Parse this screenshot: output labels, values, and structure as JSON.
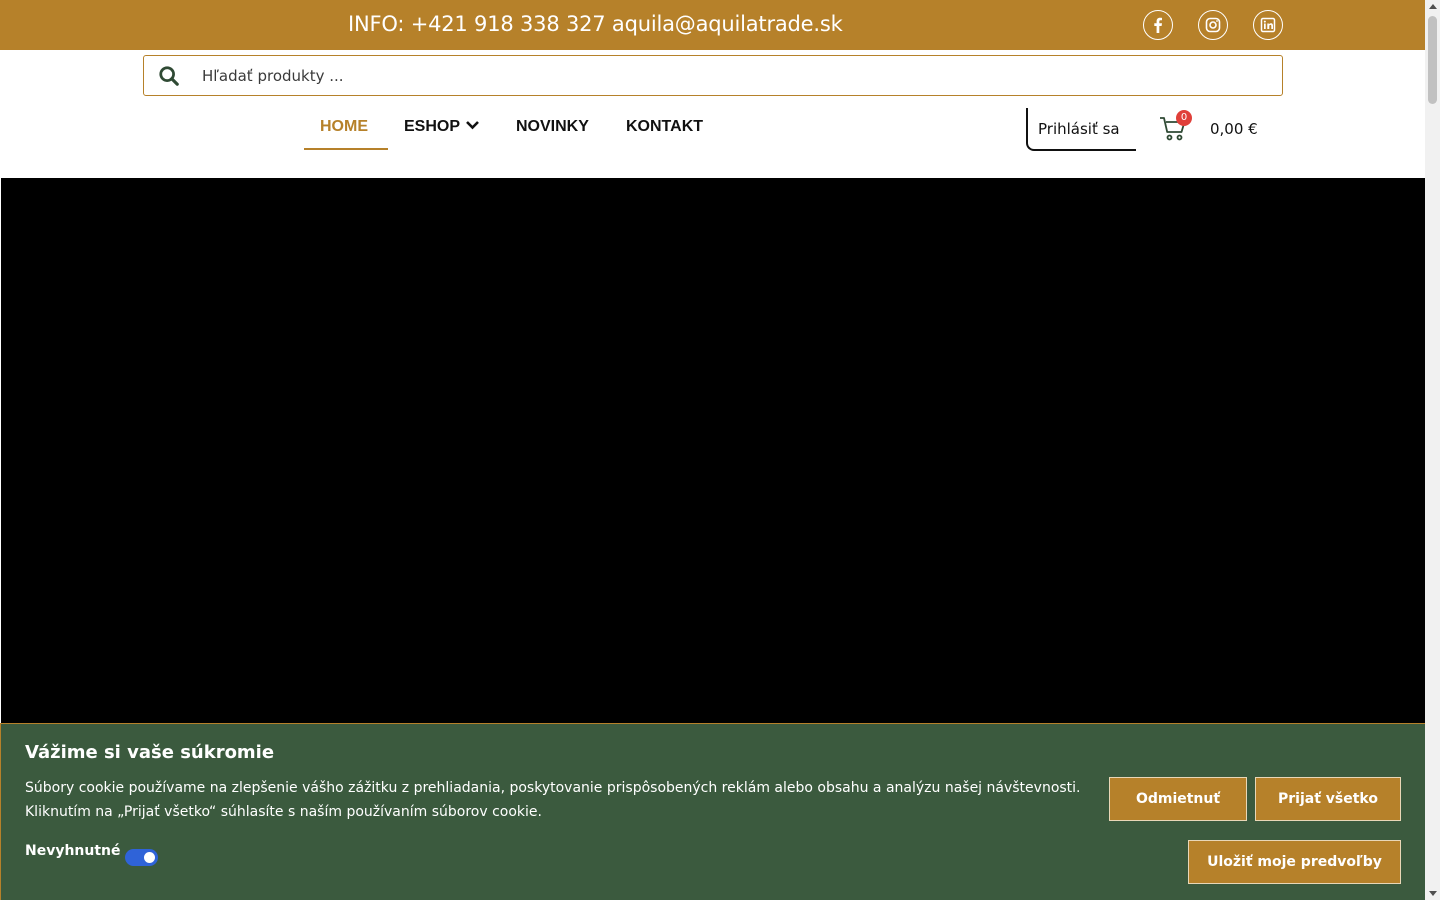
{
  "topbar": {
    "info": "INFO: +421 918 338 327 aquila@aquilatrade.sk",
    "social": [
      "facebook-icon",
      "instagram-icon",
      "linkedin-icon"
    ]
  },
  "search": {
    "placeholder": "Hľadať produkty ..."
  },
  "nav": {
    "items": [
      {
        "label": "HOME",
        "active": true
      },
      {
        "label": "ESHOP",
        "has_dropdown": true
      },
      {
        "label": "NOVINKY"
      },
      {
        "label": "KONTAKT"
      }
    ]
  },
  "account": {
    "login_label": "Prihlásiť sa",
    "cart_count": "0",
    "cart_total": "0,00 €"
  },
  "cookie": {
    "title": "Vážime si vaše súkromie",
    "text": "Súbory cookie používame na zlepšenie vášho zážitku z prehliadania, poskytovanie prispôsobených reklám alebo obsahu a analýzu našej návštevnosti. Kliknutím na „Prijať všetko“ súhlasíte s naším používaním súborov cookie.",
    "necessary_label": "Nevyhnutné",
    "necessary_enabled": true,
    "reject_label": "Odmietnuť",
    "accept_label": "Prijať všetko",
    "save_label": "Uložiť moje predvoľby"
  },
  "colors": {
    "brand_gold": "#b6812a",
    "banner_green": "#3b5a3e",
    "toggle_blue": "#2f63d8"
  }
}
